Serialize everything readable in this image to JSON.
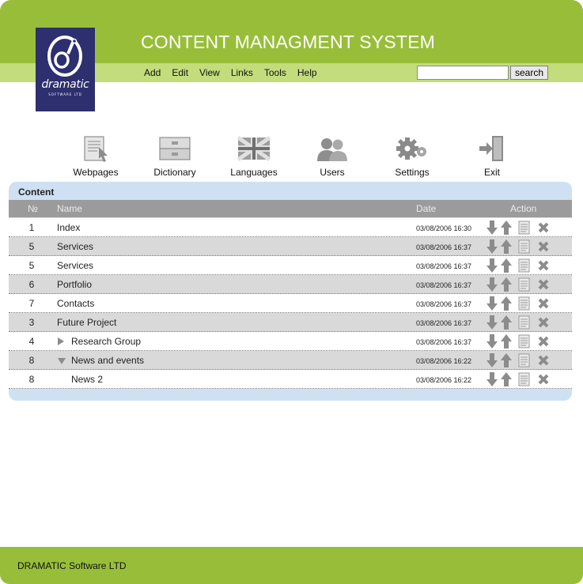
{
  "header": {
    "title": "CONTENT MANAGMENT SYSTEM",
    "logo_word": "dramatic",
    "logo_sub": "SOFTWARE LTD"
  },
  "menu": [
    "Add",
    "Edit",
    "View",
    "Links",
    "Tools",
    "Help"
  ],
  "search": {
    "value": "",
    "button_label": "search"
  },
  "toolbar": [
    {
      "label": "Webpages",
      "icon": "webpages-icon"
    },
    {
      "label": "Dictionary",
      "icon": "dictionary-icon"
    },
    {
      "label": "Languages",
      "icon": "union-jack-flag-icon"
    },
    {
      "label": "Users",
      "icon": "users-icon"
    },
    {
      "label": "Settings",
      "icon": "gears-icon"
    },
    {
      "label": "Exit",
      "icon": "exit-door-icon"
    }
  ],
  "content": {
    "title": "Content",
    "columns": {
      "num": "№",
      "name": "Name",
      "date": "Date",
      "action": "Action"
    },
    "rows": [
      {
        "num": "1",
        "name": "Index",
        "date": "03/08/2006 16:30"
      },
      {
        "num": "5",
        "name": "Services",
        "date": "03/08/2006 16:37"
      },
      {
        "num": "5",
        "name": "Services",
        "date": "03/08/2006 16:37"
      },
      {
        "num": "6",
        "name": "Portfolio",
        "date": "03/08/2006 16:37"
      },
      {
        "num": "7",
        "name": "Contacts",
        "date": "03/08/2006 16:37"
      },
      {
        "num": "3",
        "name": "Future Project",
        "date": "03/08/2006 16:37"
      },
      {
        "num": "4",
        "name": "Research Group",
        "date": "03/08/2006 16:37",
        "expander": "collapsed"
      },
      {
        "num": "8",
        "name": "News and events",
        "date": "03/08/2006 16:22",
        "expander": "expanded"
      },
      {
        "num": "8",
        "name": "News 2",
        "date": "03/08/2006 16:22",
        "child": true
      }
    ]
  },
  "footer": {
    "text": "DRAMATIC Software LTD"
  },
  "colors": {
    "green": "#98be39",
    "light_green": "#c3dd7c",
    "panel_blue": "#cfe0f3",
    "logo_navy": "#2d2f6e",
    "header_gray": "#9b9b9b"
  }
}
